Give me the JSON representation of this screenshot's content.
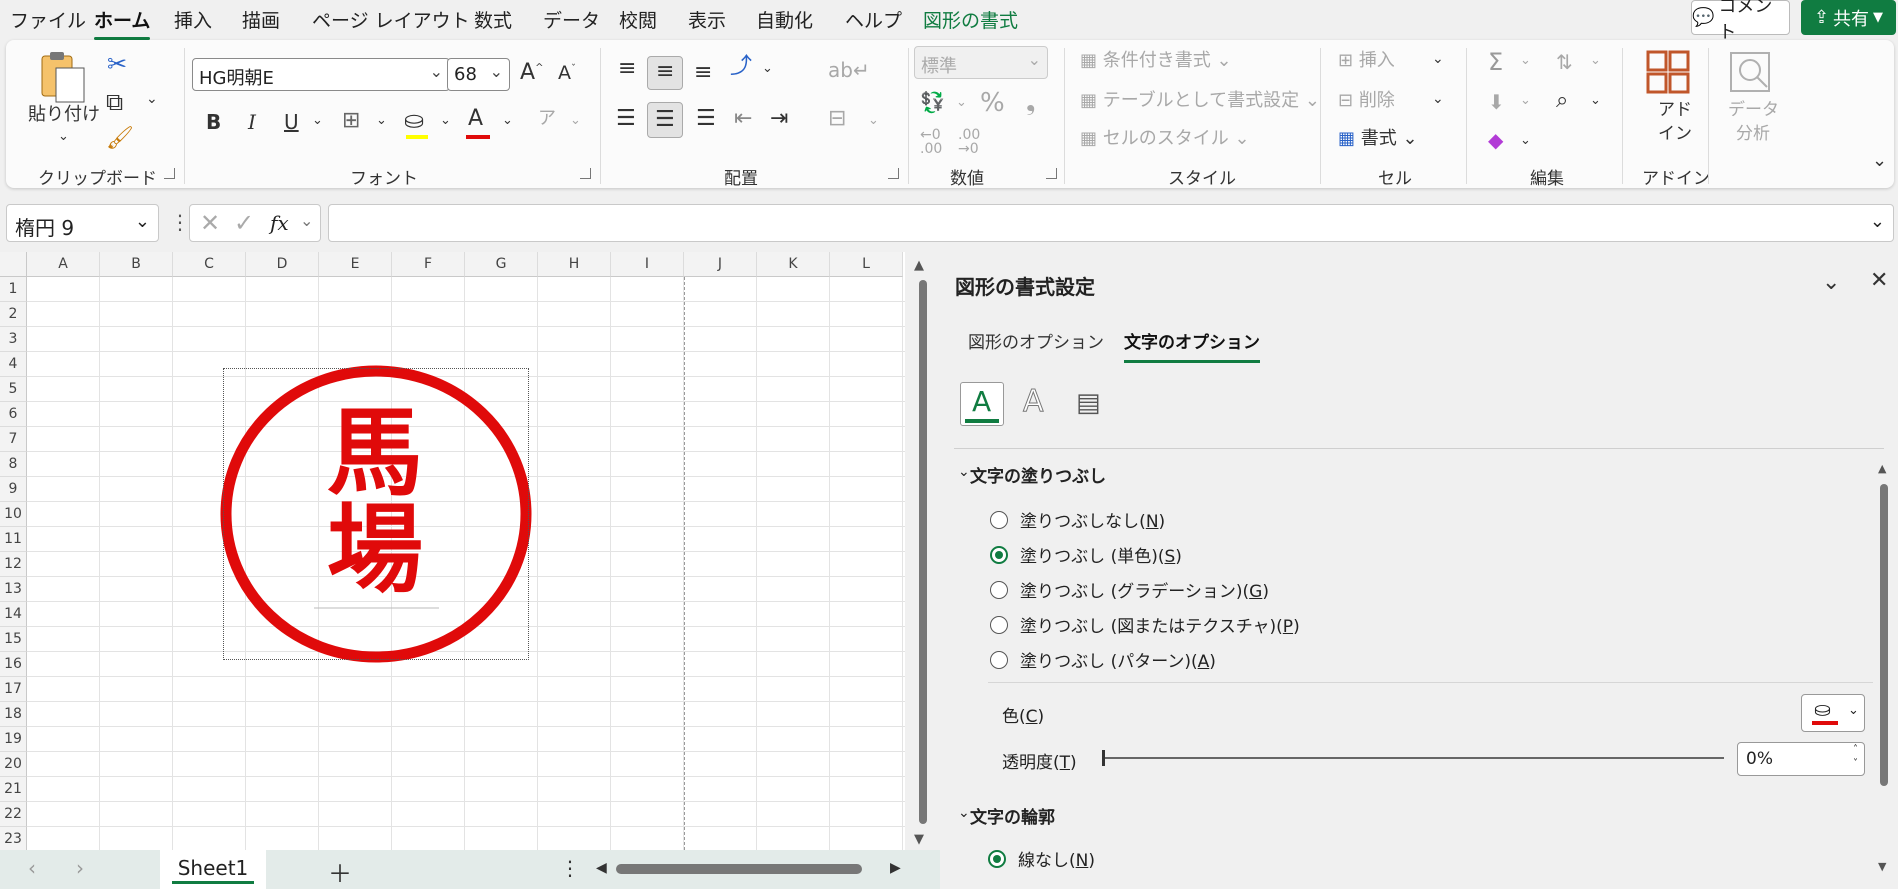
{
  "ribbon_tabs": [
    "ファイル",
    "ホーム",
    "挿入",
    "描画",
    "ページ レイアウト",
    "数式",
    "データ",
    "校閲",
    "表示",
    "自動化",
    "ヘルプ",
    "図形の書式"
  ],
  "active_tab": "ホーム",
  "comment_label": "コメント",
  "share_label": "共有",
  "clipboard": {
    "paste_label": "貼り付け",
    "group": "クリップボード"
  },
  "font": {
    "name": "HG明朝E",
    "size": "68",
    "group": "フォント"
  },
  "alignment": {
    "group": "配置"
  },
  "number": {
    "format": "標準",
    "group": "数値"
  },
  "styles": {
    "conditional": "条件付き書式",
    "table": "テーブルとして書式設定",
    "cell_styles": "セルのスタイル",
    "group": "スタイル"
  },
  "cells": {
    "insert": "挿入",
    "delete": "削除",
    "format": "書式",
    "group": "セル"
  },
  "editing": {
    "group": "編集"
  },
  "addins": {
    "label_1": "アド",
    "label_2": "イン",
    "group": "アドイン"
  },
  "analysis": {
    "label_1": "データ",
    "label_2": "分析"
  },
  "namebox": "楕円 9",
  "fx": "fx",
  "columns": [
    "A",
    "B",
    "C",
    "D",
    "E",
    "F",
    "G",
    "H",
    "I",
    "J",
    "K",
    "L"
  ],
  "rows": [
    "1",
    "2",
    "3",
    "4",
    "5",
    "6",
    "7",
    "8",
    "9",
    "10",
    "11",
    "12",
    "13",
    "14",
    "15",
    "16",
    "17",
    "18",
    "19",
    "20",
    "21",
    "22",
    "23"
  ],
  "stamp": {
    "char1": "馬",
    "char2": "場",
    "color": "#e00a0a"
  },
  "sheet_tab": "Sheet1",
  "pane": {
    "title": "図形の書式設定",
    "tab_shape": "図形のオプション",
    "tab_text": "文字のオプション",
    "section_fill": "文字の塗りつぶし",
    "fill_options": [
      {
        "text": "塗りつぶしなし(",
        "key": "N",
        "selected": false
      },
      {
        "text": "塗りつぶし (単色)(",
        "key": "S",
        "selected": true
      },
      {
        "text": "塗りつぶし (グラデーション)(",
        "key": "G",
        "selected": false
      },
      {
        "text": "塗りつぶし (図またはテクスチャ)(",
        "key": "P",
        "selected": false
      },
      {
        "text": "塗りつぶし (パターン)(",
        "key": "A",
        "selected": false
      }
    ],
    "color_label": "色(",
    "color_key": "C",
    "transparency_label": "透明度(",
    "transparency_key": "T",
    "transparency_value": "0%",
    "section_outline": "文字の輪郭",
    "outline_option": "線なし(",
    "outline_key": "N"
  },
  "accent": "#107c41"
}
